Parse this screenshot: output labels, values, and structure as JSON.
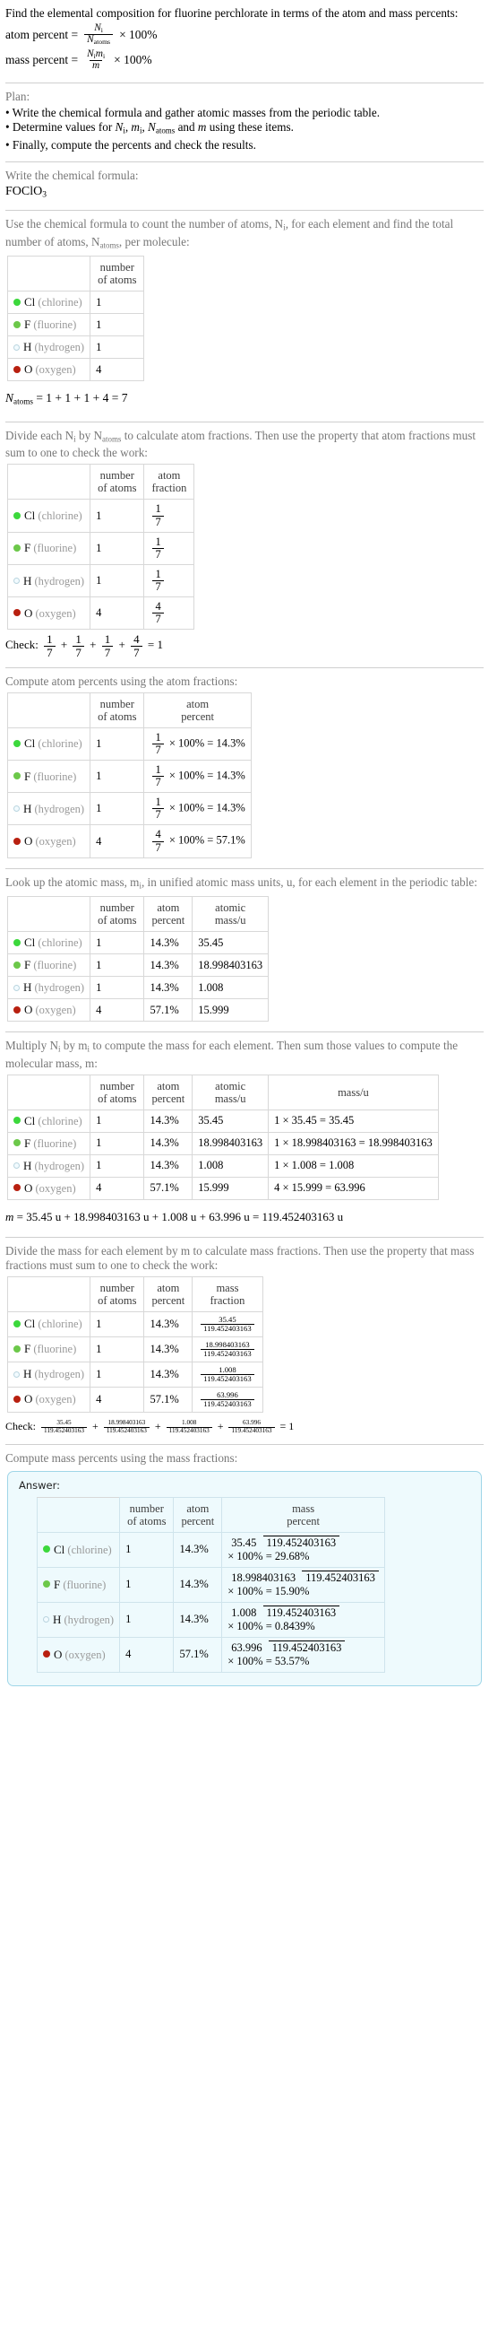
{
  "intro": {
    "question": "Find the elemental composition for fluorine perchlorate in terms of the atom and mass percents:",
    "atom_percent_label": "atom percent =",
    "mass_percent_label": "mass percent =",
    "atom_percent_num": "N",
    "atom_percent_num_sub": "i",
    "atom_percent_den": "N",
    "atom_percent_den_sub": "atoms",
    "mass_percent_num": "N m",
    "mass_percent_den": "m",
    "times_100": "× 100%"
  },
  "plan": {
    "title": "Plan:",
    "bullets": [
      "• Write the chemical formula and gather atomic masses from the periodic table.",
      "• Determine values for Nᵢ, mᵢ, Nₐₜₒₘₛ and m using these items.",
      "• Finally, compute the percents and check the results."
    ]
  },
  "formula_section": {
    "prompt": "Write the chemical formula:",
    "formula_main": "FOClO",
    "formula_sub": "3"
  },
  "elements": [
    {
      "symbol": "Cl",
      "name": "(chlorine)",
      "color": "#3cd83c",
      "filled": true,
      "count": "1",
      "fraction_num": "1",
      "fraction_den": "7",
      "atom_percent": "14.3%",
      "atomic_mass": "35.45",
      "mass_expr": "1 × 35.45 = 35.45",
      "mass_value": "35.45",
      "mass_percent": "29.68%"
    },
    {
      "symbol": "F",
      "name": "(fluorine)",
      "color": "#6cc84a",
      "filled": true,
      "count": "1",
      "fraction_num": "1",
      "fraction_den": "7",
      "atom_percent": "14.3%",
      "atomic_mass": "18.998403163",
      "mass_expr": "1 × 18.998403163 = 18.998403163",
      "mass_value": "18.998403163",
      "mass_percent": "15.90%"
    },
    {
      "symbol": "H",
      "name": "(hydrogen)",
      "color": "#f2fbff",
      "filled": false,
      "count": "1",
      "fraction_num": "1",
      "fraction_den": "7",
      "atom_percent": "14.3%",
      "atomic_mass": "1.008",
      "mass_expr": "1 × 1.008 = 1.008",
      "mass_value": "1.008",
      "mass_percent": "0.8439%"
    },
    {
      "symbol": "O",
      "name": "(oxygen)",
      "color": "#b82010",
      "filled": true,
      "count": "4",
      "fraction_num": "4",
      "fraction_den": "7",
      "atom_percent": "57.1%",
      "atomic_mass": "15.999",
      "mass_expr": "4 × 15.999 = 63.996",
      "mass_value": "63.996",
      "mass_percent": "53.57%"
    }
  ],
  "headers": {
    "number_of_atoms_l1": "number",
    "number_of_atoms_l2": "of atoms",
    "atom_fraction_l1": "atom",
    "atom_fraction_l2": "fraction",
    "atom_percent_l1": "atom",
    "atom_percent_l2": "percent",
    "atomic_mass_l1": "atomic",
    "atomic_mass_l2": "mass/u",
    "mass_u": "mass/u",
    "mass_fraction_l1": "mass",
    "mass_fraction_l2": "fraction",
    "mass_percent_l1": "mass",
    "mass_percent_l2": "percent"
  },
  "count_section": {
    "prompt_l1": "Use the chemical formula to count the number of atoms, N",
    "prompt_sub1": "i",
    "prompt_l2": ", for each element",
    "prompt_l3": "and find the total number of atoms, N",
    "prompt_sub2": "atoms",
    "prompt_l4": ", per molecule:",
    "total_label": "N",
    "total_sub": "atoms",
    "total_expr": "= 1 + 1 + 1 + 4 = 7"
  },
  "fraction_section": {
    "prompt_l1": "Divide each N",
    "prompt_sub1": "i",
    "prompt_l2": " by N",
    "prompt_sub2": "atoms",
    "prompt_l3": " to calculate atom fractions. Then use the property that",
    "prompt_l4": "atom fractions must sum to one to check the work:",
    "check_label": "Check:",
    "check_result": "= 1"
  },
  "atom_percent_section": {
    "prompt": "Compute atom percents using the atom fractions:",
    "times_100": "× 100% ="
  },
  "atomic_mass_section": {
    "prompt_l1": "Look up the atomic mass, m",
    "prompt_sub": "i",
    "prompt_l2": ", in unified atomic mass units, u, for each element in",
    "prompt_l3": "the periodic table:"
  },
  "mass_section": {
    "prompt_l1": "Multiply N",
    "prompt_sub1": "i",
    "prompt_l2": " by m",
    "prompt_sub2": "i",
    "prompt_l3": " to compute the mass for each element. Then sum those values",
    "prompt_l4": "to compute the molecular mass, m:",
    "total_label": "m",
    "total_expr": "= 35.45 u + 18.998403163 u + 1.008 u + 63.996 u = 119.452403163 u"
  },
  "mass_fraction_section": {
    "prompt_l1": "Divide the mass for each element by m to calculate mass fractions. Then use the",
    "prompt_l2": "property that mass fractions must sum to one to check the work:",
    "denominator": "119.452403163",
    "check_label": "Check:",
    "check_result": "= 1"
  },
  "mass_percent_section": {
    "prompt": "Compute mass percents using the mass fractions:",
    "answer_label": "Answer:",
    "denominator": "119.452403163",
    "times_100": "× 100% ="
  }
}
